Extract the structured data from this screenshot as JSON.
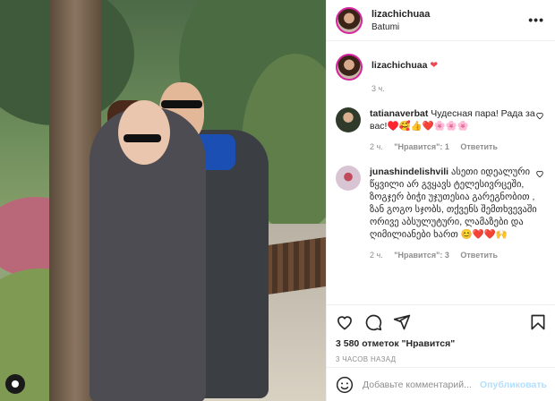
{
  "photo": {
    "alt_icon": "profile-icon"
  },
  "header": {
    "username": "lizachichuaa",
    "location": "Batumi",
    "more": "•••"
  },
  "caption": {
    "username": "lizachichuaa",
    "heart": "❤",
    "time": "3 ч."
  },
  "comments": [
    {
      "username": "tatianaverbat",
      "text": "Чудесная пара! Рада за вас!♥️🥰👍❤️🌸🌸🌸",
      "time": "2 ч.",
      "likes": "\"Нравится\": 1",
      "reply": "Ответить",
      "avatar_color": "#2f3a2a"
    },
    {
      "username": "junashindelishvili",
      "text": "ასეთი იდეალური წყვილი არ გვყავს ტელესივრცეში, ზოგჯერ ბიჭი უჯუთესია გარეგნობით , ზან გოგო სჯობს, თქვენს შემთხვევაში ორივე აბსულუტური, ლამაზები და ღიმილიანები ხართ 😊❤️❤️🙌",
      "time": "2 ч.",
      "likes": "\"Нравится\": 3",
      "reply": "Ответить",
      "avatar_color": "#c9b2c4"
    }
  ],
  "actions": {
    "likes": "3 580 отметок \"Нравится\"",
    "time": "3 ЧАСОВ НАЗАД"
  },
  "add_comment": {
    "placeholder": "Добавьте комментарий...",
    "publish": "Опубликовать"
  },
  "colors": {
    "accent": "#0095f6",
    "like_red": "#ed4956",
    "muted": "#8e8e8e"
  }
}
